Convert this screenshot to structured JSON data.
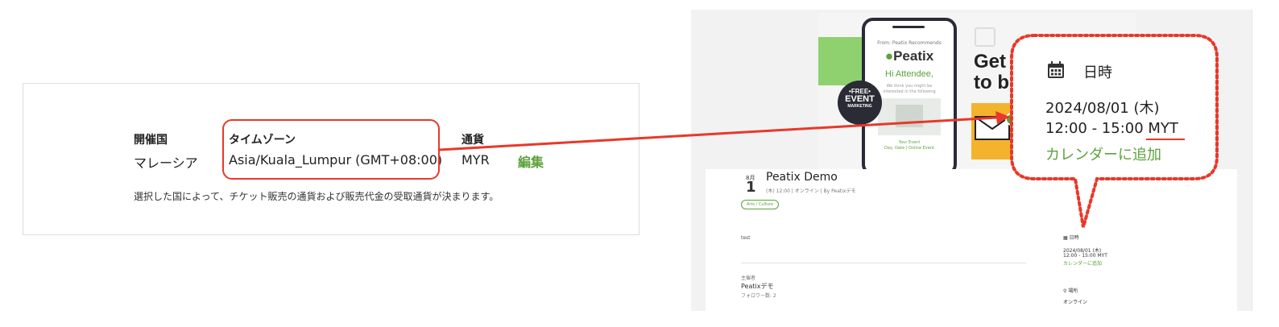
{
  "settings": {
    "country_label": "開催国",
    "country_value": "マレーシア",
    "timezone_label": "タイムゾーン",
    "timezone_value": "Asia/Kuala_Lumpur (GMT+08:00)",
    "currency_label": "通貨",
    "currency_value": "MYR",
    "edit_label": "編集",
    "note": "選択した国によって、チケット販売の通貨および販売代金の受取通貨が決まります。"
  },
  "banner": {
    "phone_from": "From: Peatix Recommends",
    "phone_logo": "Peatix",
    "phone_greeting": "Hi Attendee,",
    "phone_small_line1": "We think you might be",
    "phone_small_line2": "interested in the following",
    "phone_event_line1": "Your Event",
    "phone_event_line2": "Day, Date | Online Event",
    "badge_line1": "•FREE•",
    "badge_line2": "EVENT",
    "badge_line3": "MARKETING",
    "headline_line1": "Get",
    "headline_line2": "to b"
  },
  "event": {
    "month": "8月",
    "day": "1",
    "title": "Peatix Demo",
    "meta": "(木) 12:00 | オンライン | By Peatixデモ",
    "tag": "Arts / Culture",
    "description": "test",
    "organizer_label": "主催者",
    "organizer_name": "Peatixデモ",
    "followers": "フォロワー数: 2",
    "more": "···",
    "datetime_label": "日時",
    "date": "2024/08/01 (木)",
    "time": "12:00 - 15:00 MYT",
    "add_calendar": "カレンダーに追加",
    "venue_label": "場所",
    "venue": "オンライン"
  },
  "callout": {
    "heading": "日時",
    "date": "2024/08/01 (木)",
    "time": "12:00 - 15:00 MYT",
    "add_calendar": "カレンダーに追加"
  },
  "colors": {
    "accent_green": "#5ba23a",
    "highlight_red": "#e8382a"
  }
}
